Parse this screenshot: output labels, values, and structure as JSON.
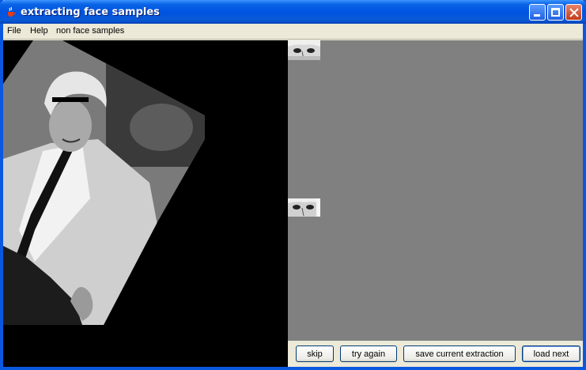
{
  "window": {
    "title": "extracting face samples",
    "app_icon": "java-cup-icon"
  },
  "title_buttons": {
    "minimize": "minimize-icon",
    "maximize": "maximize-icon",
    "close": "close-icon"
  },
  "menu": {
    "items": [
      "File",
      "Help",
      "non face samples"
    ]
  },
  "main_image": {
    "description_icon": "photo-rotated-man"
  },
  "samples": {
    "count": 2
  },
  "buttons": {
    "skip": "skip",
    "try_again": "try again",
    "save": "save current extraction",
    "load_next": "load next"
  },
  "colors": {
    "title_blue": "#0053e1",
    "sample_bg": "#808080",
    "frame": "#ece9d8"
  }
}
